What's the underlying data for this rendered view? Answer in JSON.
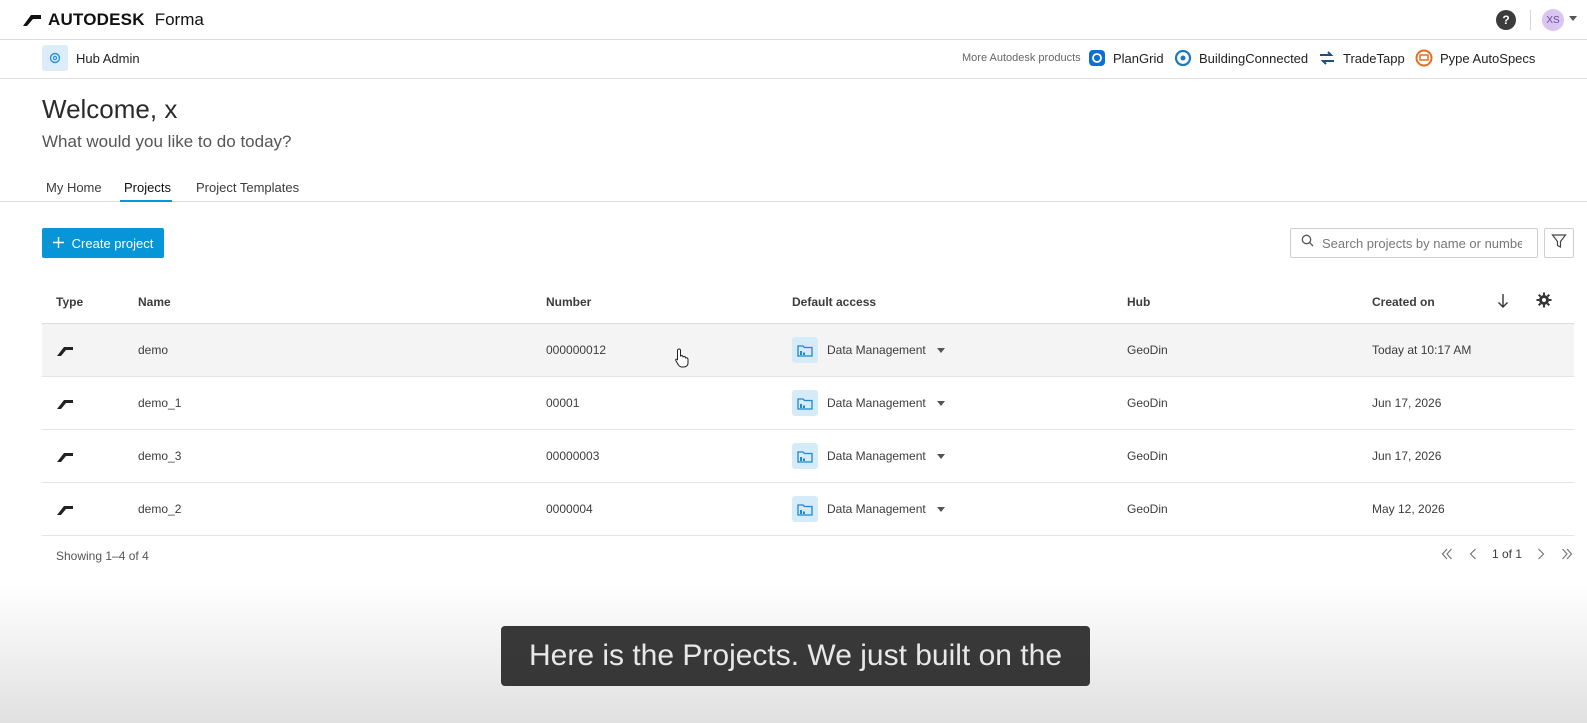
{
  "topbar": {
    "brand": "AUTODESK",
    "product": "Forma",
    "help": "?",
    "avatar_initials": "XS"
  },
  "subbar": {
    "hub_admin": "Hub Admin",
    "more_products": "More Autodesk products",
    "products": [
      "PlanGrid",
      "BuildingConnected",
      "TradeTapp",
      "Pype AutoSpecs"
    ]
  },
  "welcome": {
    "title": "Welcome, x",
    "subtitle": "What would you like to do today?"
  },
  "tabs": [
    "My Home",
    "Projects",
    "Project Templates"
  ],
  "actions": {
    "create_label": "Create project",
    "search_placeholder": "Search projects by name or numbe..."
  },
  "table": {
    "headers": [
      "Type",
      "Name",
      "Number",
      "Default access",
      "Hub",
      "Created on"
    ],
    "rows": [
      {
        "name": "demo",
        "number": "000000012",
        "access": "Data Management",
        "hub": "GeoDin",
        "created": "Today at 10:17 AM"
      },
      {
        "name": "demo_1",
        "number": "00001",
        "access": "Data Management",
        "hub": "GeoDin",
        "created": "Jun 17, 2026"
      },
      {
        "name": "demo_3",
        "number": "00000003",
        "access": "Data Management",
        "hub": "GeoDin",
        "created": "Jun 17, 2026"
      },
      {
        "name": "demo_2",
        "number": "0000004",
        "access": "Data Management",
        "hub": "GeoDin",
        "created": "May 12, 2026"
      }
    ]
  },
  "footer": {
    "showing": "Showing 1–4 of 4",
    "page": "1 of 1"
  },
  "caption": "Here is the Projects. We just built on the",
  "colors": {
    "accent": "#0696d7",
    "caption_bg": "#1e1e1e"
  }
}
